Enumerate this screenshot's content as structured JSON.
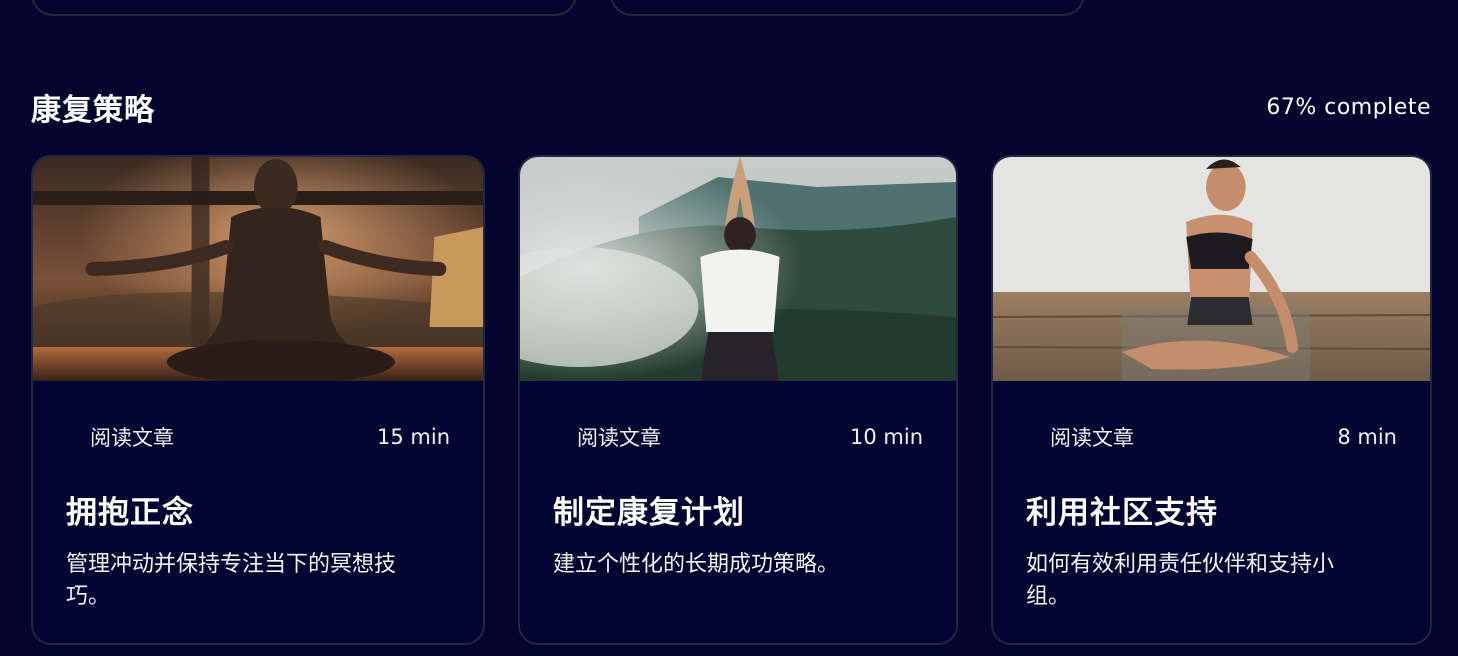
{
  "section": {
    "title": "康复策略",
    "progress": "67% complete"
  },
  "cards": [
    {
      "type_label": "阅读文章",
      "duration": "15 min",
      "title": "拥抱正念",
      "description": "管理冲动并保持专注当下的冥想技巧。",
      "image": "meditation-sunset-photo"
    },
    {
      "type_label": "阅读文章",
      "duration": "10 min",
      "title": "制定康复计划",
      "description": "建立个性化的长期成功策略。",
      "image": "yoga-mountain-photo"
    },
    {
      "type_label": "阅读文章",
      "duration": "8 min",
      "title": "利用社区支持",
      "description": "如何有效利用责任伙伴和支持小组。",
      "image": "yoga-studio-photo"
    }
  ],
  "colors": {
    "background": "#03052e",
    "card_border": "#24273d",
    "text": "#ffffff"
  }
}
